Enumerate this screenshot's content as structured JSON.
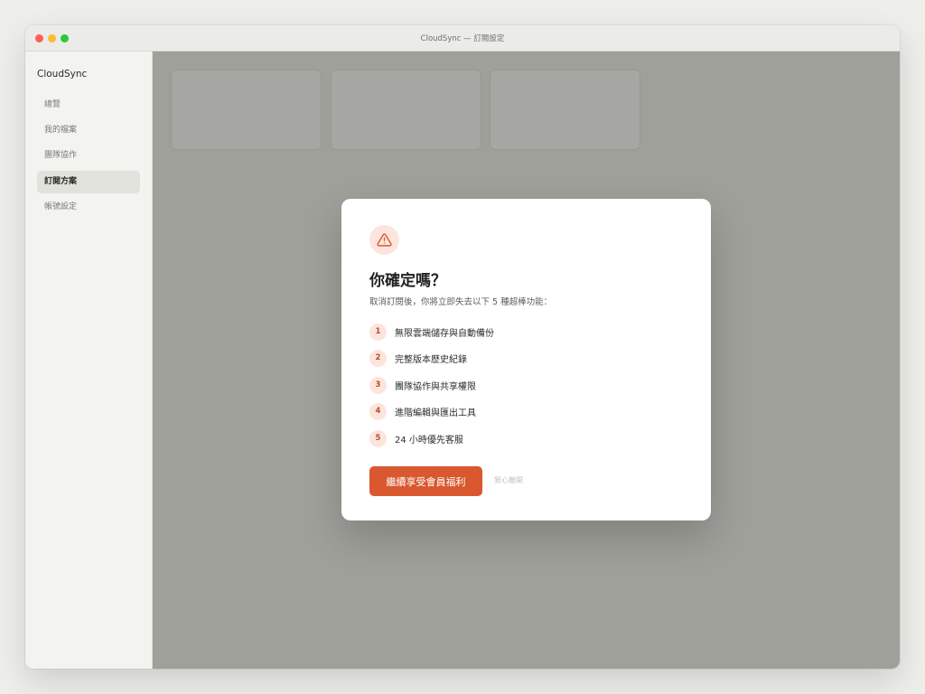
{
  "window": {
    "title": "CloudSync — 訂閱設定"
  },
  "sidebar": {
    "brand": "CloudSync",
    "items": [
      {
        "label": "總覽",
        "active": false
      },
      {
        "label": "我的檔案",
        "active": false
      },
      {
        "label": "團隊協作",
        "active": false
      },
      {
        "label": "訂閱方案",
        "active": true
      },
      {
        "label": "帳號設定",
        "active": false
      }
    ]
  },
  "modal": {
    "icon": "warning-triangle-icon",
    "title": "你確定嗎？",
    "subtitle": "取消訂閱後，你將立即失去以下 5 種超棒功能：",
    "benefits": [
      {
        "num": "1",
        "text": "無限雲端儲存與自動備份"
      },
      {
        "num": "2",
        "text": "完整版本歷史紀錄"
      },
      {
        "num": "3",
        "text": "團隊協作與共享權限"
      },
      {
        "num": "4",
        "text": "進階編輯與匯出工具"
      },
      {
        "num": "5",
        "text": "24 小時優先客服"
      }
    ],
    "primary_label": "繼續享受會員福利",
    "secondary_label": "狠心離開"
  },
  "colors": {
    "accent": "#d9582f",
    "accent_soft": "#fbe5dc",
    "overlay": "#46443e"
  }
}
